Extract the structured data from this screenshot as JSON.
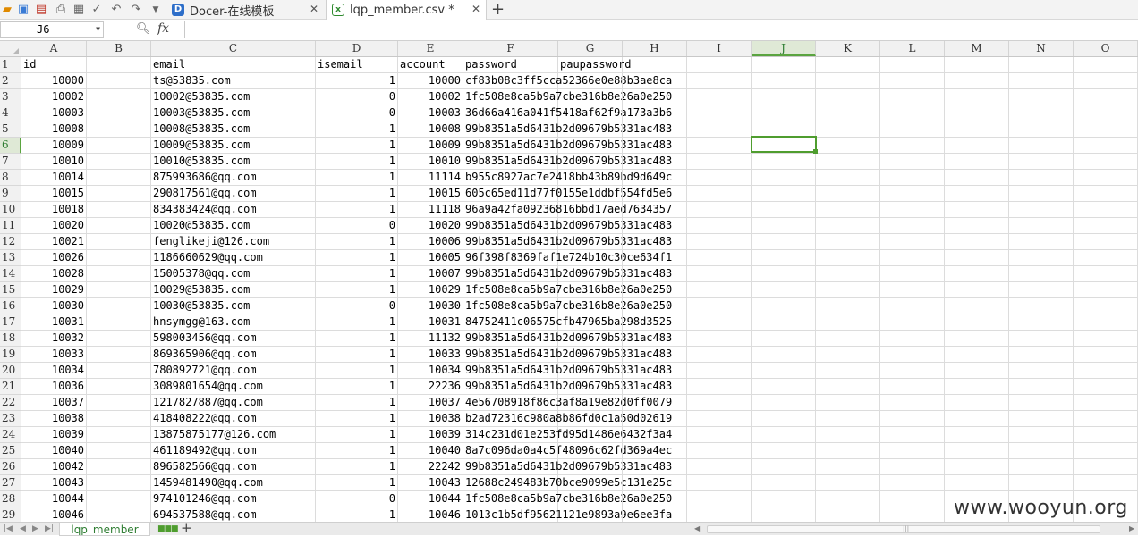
{
  "toolbar": {
    "icons": [
      "open-folder-icon",
      "save-icon",
      "export-pdf-icon",
      "print-icon",
      "print-preview-icon",
      "spellcheck-icon",
      "undo-icon",
      "redo-icon",
      "more-dropdown-icon"
    ]
  },
  "tabs": [
    {
      "label": "Docer-在线模板",
      "icon": "docer-icon",
      "active": false
    },
    {
      "label": "lqp_member.csv *",
      "icon": "csv-file-icon",
      "active": true
    }
  ],
  "formula_bar": {
    "cell_ref": "J6",
    "fx": "fx",
    "value": ""
  },
  "columns": [
    "A",
    "B",
    "C",
    "D",
    "E",
    "F",
    "G",
    "H",
    "I",
    "J",
    "K",
    "L",
    "M",
    "N",
    "O"
  ],
  "selected_column": "J",
  "selected_row": "6",
  "sheet": {
    "header_row": {
      "id": "id",
      "email": "email",
      "isemail": "isemail",
      "account": "account",
      "password": "password",
      "paupassword": "paupassword"
    },
    "rows": [
      {
        "n": "2",
        "id": "10000",
        "email": "ts@53835.com",
        "isemail": "1",
        "account": "10000",
        "password": "cf83b08c3ff5cca52366e0e88b3ae8ca"
      },
      {
        "n": "3",
        "id": "10002",
        "email": "10002@53835.com",
        "isemail": "0",
        "account": "10002",
        "password": "1fc508e8ca5b9a7cbe316b8e26a0e250"
      },
      {
        "n": "4",
        "id": "10003",
        "email": "10003@53835.com",
        "isemail": "0",
        "account": "10003",
        "password": "36d66a416a041f5418af62f9a173a3b6"
      },
      {
        "n": "5",
        "id": "10008",
        "email": "10008@53835.com",
        "isemail": "1",
        "account": "10008",
        "password": "99b8351a5d6431b2d09679b5331ac483"
      },
      {
        "n": "6",
        "id": "10009",
        "email": "10009@53835.com",
        "isemail": "1",
        "account": "10009",
        "password": "99b8351a5d6431b2d09679b5331ac483"
      },
      {
        "n": "7",
        "id": "10010",
        "email": "10010@53835.com",
        "isemail": "1",
        "account": "10010",
        "password": "99b8351a5d6431b2d09679b5331ac483"
      },
      {
        "n": "8",
        "id": "10014",
        "email": "875993686@qq.com",
        "isemail": "1",
        "account": "11114",
        "password": "b955c8927ac7e2418bb43b89bd9d649c"
      },
      {
        "n": "9",
        "id": "10015",
        "email": "290817561@qq.com",
        "isemail": "1",
        "account": "10015",
        "password": "605c65ed11d77f0155e1ddbf554fd5e6"
      },
      {
        "n": "10",
        "id": "10018",
        "email": "834383424@qq.com",
        "isemail": "1",
        "account": "11118",
        "password": "96a9a42fa09236816bbd17aed7634357"
      },
      {
        "n": "11",
        "id": "10020",
        "email": "10020@53835.com",
        "isemail": "0",
        "account": "10020",
        "password": "99b8351a5d6431b2d09679b5331ac483"
      },
      {
        "n": "12",
        "id": "10021",
        "email": "fenglikeji@126.com",
        "isemail": "1",
        "account": "10006",
        "password": "99b8351a5d6431b2d09679b5331ac483"
      },
      {
        "n": "13",
        "id": "10026",
        "email": "1186660629@qq.com",
        "isemail": "1",
        "account": "10005",
        "password": "96f398f8369faf1e724b10c30ce634f1"
      },
      {
        "n": "14",
        "id": "10028",
        "email": "15005378@qq.com",
        "isemail": "1",
        "account": "10007",
        "password": "99b8351a5d6431b2d09679b5331ac483"
      },
      {
        "n": "15",
        "id": "10029",
        "email": "10029@53835.com",
        "isemail": "1",
        "account": "10029",
        "password": "1fc508e8ca5b9a7cbe316b8e26a0e250"
      },
      {
        "n": "16",
        "id": "10030",
        "email": "10030@53835.com",
        "isemail": "0",
        "account": "10030",
        "password": "1fc508e8ca5b9a7cbe316b8e26a0e250"
      },
      {
        "n": "17",
        "id": "10031",
        "email": "hnsymgg@163.com",
        "isemail": "1",
        "account": "10031",
        "password": "84752411c06575cfb47965ba298d3525"
      },
      {
        "n": "18",
        "id": "10032",
        "email": "598003456@qq.com",
        "isemail": "1",
        "account": "11132",
        "password": "99b8351a5d6431b2d09679b5331ac483"
      },
      {
        "n": "19",
        "id": "10033",
        "email": "869365906@qq.com",
        "isemail": "1",
        "account": "10033",
        "password": "99b8351a5d6431b2d09679b5331ac483"
      },
      {
        "n": "20",
        "id": "10034",
        "email": "780892721@qq.com",
        "isemail": "1",
        "account": "10034",
        "password": "99b8351a5d6431b2d09679b5331ac483"
      },
      {
        "n": "21",
        "id": "10036",
        "email": "3089801654@qq.com",
        "isemail": "1",
        "account": "22236",
        "password": "99b8351a5d6431b2d09679b5331ac483"
      },
      {
        "n": "22",
        "id": "10037",
        "email": "1217827887@qq.com",
        "isemail": "1",
        "account": "10037",
        "password": "4e56708918f86c3af8a19e82d0ff0079"
      },
      {
        "n": "23",
        "id": "10038",
        "email": "418408222@qq.com",
        "isemail": "1",
        "account": "10038",
        "password": "b2ad72316c980a8b86fd0c1a50d02619"
      },
      {
        "n": "24",
        "id": "10039",
        "email": "13875875177@126.com",
        "isemail": "1",
        "account": "10039",
        "password": "314c231d01e253fd95d1486e6432f3a4"
      },
      {
        "n": "25",
        "id": "10040",
        "email": "461189492@qq.com",
        "isemail": "1",
        "account": "10040",
        "password": "8a7c096da0a4c5f48096c62fd369a4ec"
      },
      {
        "n": "26",
        "id": "10042",
        "email": "896582566@qq.com",
        "isemail": "1",
        "account": "22242",
        "password": "99b8351a5d6431b2d09679b5331ac483"
      },
      {
        "n": "27",
        "id": "10043",
        "email": "1459481490@qq.com",
        "isemail": "1",
        "account": "10043",
        "password": "12688c249483b70bce9099e5c131e25c"
      },
      {
        "n": "28",
        "id": "10044",
        "email": "974101246@qq.com",
        "isemail": "0",
        "account": "10044",
        "password": "1fc508e8ca5b9a7cbe316b8e26a0e250"
      },
      {
        "n": "29",
        "id": "10046",
        "email": "694537588@qq.com",
        "isemail": "1",
        "account": "10046",
        "password": "1013c1b5df95621121e9893a9e6ee3fa"
      }
    ]
  },
  "sheet_tab": {
    "label": "lqp_member"
  },
  "watermark": "www.wooyun.org",
  "colors": {
    "accent": "#4f9d2f",
    "header_bg": "#f1f1f1",
    "selection_header": "#dfe9d6"
  }
}
